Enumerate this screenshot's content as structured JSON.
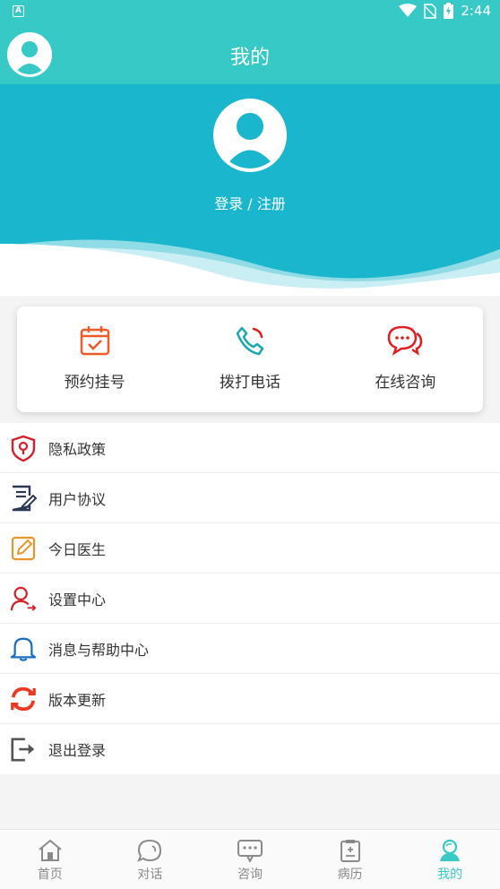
{
  "status_bar": {
    "time": "2:44",
    "left_badge": "A"
  },
  "header": {
    "title": "我的"
  },
  "profile": {
    "login_text": "登录 / 注册"
  },
  "quick_actions": [
    {
      "label": "预约挂号",
      "icon": "calendar-check-icon",
      "color": "#f05a28"
    },
    {
      "label": "拨打电话",
      "icon": "phone-icon",
      "color": "#1aa6b0"
    },
    {
      "label": "在线咨询",
      "icon": "chat-bubbles-icon",
      "color": "#e02020"
    }
  ],
  "menu": [
    {
      "label": "隐私政策",
      "icon": "shield-lock-icon"
    },
    {
      "label": "用户协议",
      "icon": "document-sign-icon"
    },
    {
      "label": "今日医生",
      "icon": "pencil-edit-icon"
    },
    {
      "label": "设置中心",
      "icon": "user-settings-icon"
    },
    {
      "label": "消息与帮助中心",
      "icon": "bell-icon"
    },
    {
      "label": "版本更新",
      "icon": "refresh-icon"
    },
    {
      "label": "退出登录",
      "icon": "logout-icon"
    }
  ],
  "tabs": [
    {
      "label": "首页",
      "icon": "home-icon",
      "active": false
    },
    {
      "label": "对话",
      "icon": "chat-icon",
      "active": false
    },
    {
      "label": "咨询",
      "icon": "consult-icon",
      "active": false
    },
    {
      "label": "病历",
      "icon": "medical-record-icon",
      "active": false
    },
    {
      "label": "我的",
      "icon": "profile-icon",
      "active": true
    }
  ],
  "colors": {
    "primary": "#36c9c6",
    "hero": "#1ab6cd",
    "tab_active": "#36c9c6"
  }
}
